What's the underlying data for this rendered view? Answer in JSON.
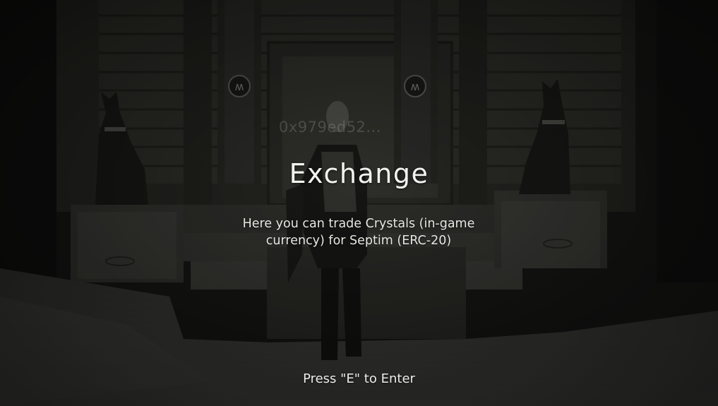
{
  "scene": {
    "player_tag": "0x979ed52...",
    "title": "Exchange",
    "description": "Here you can trade Crystals (in-game currency) for Septim (ERC-20)",
    "prompt": "Press \"E\" to Enter"
  },
  "colors": {
    "background": "#1a1a18",
    "overlay_text": "#f2f2ef",
    "stone": "#3a3a35",
    "snow": "#4a4a47"
  }
}
